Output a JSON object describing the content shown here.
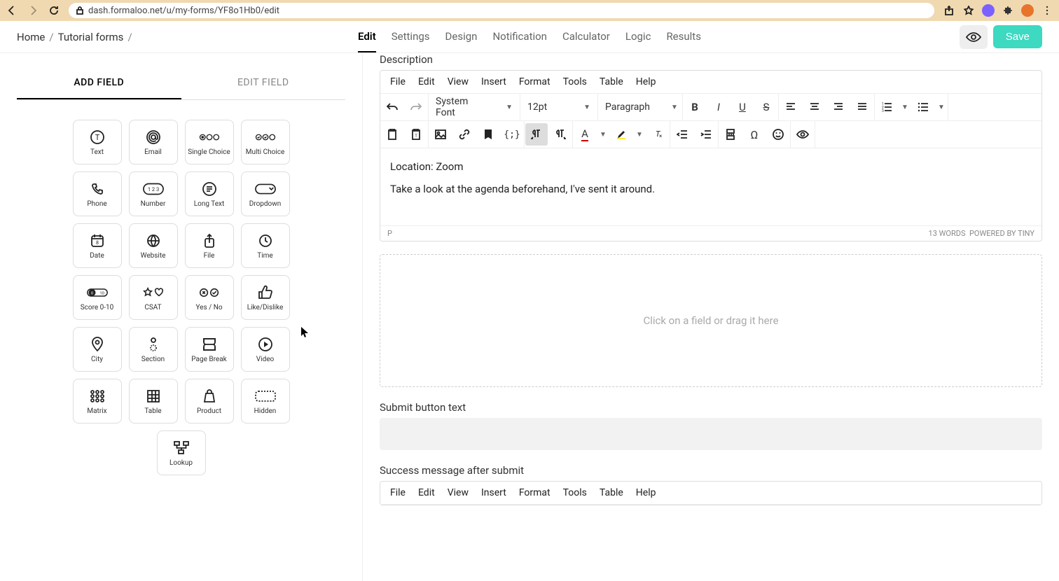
{
  "browser": {
    "url": "dash.formaloo.net/u/my-forms/YF8o1Hb0/edit"
  },
  "breadcrumb": {
    "home": "Home",
    "section": "Tutorial forms"
  },
  "tabs": [
    "Edit",
    "Settings",
    "Design",
    "Notification",
    "Calculator",
    "Logic",
    "Results"
  ],
  "header": {
    "save": "Save"
  },
  "sidebar": {
    "tab_add": "ADD FIELD",
    "tab_edit": "EDIT FIELD",
    "fields": [
      "Text",
      "Email",
      "Single Choice",
      "Multi Choice",
      "Phone",
      "Number",
      "Long Text",
      "Dropdown",
      "Date",
      "Website",
      "File",
      "Time",
      "Score 0-10",
      "CSAT",
      "Yes / No",
      "Like/Dislike",
      "City",
      "Section",
      "Page Break",
      "Video",
      "Matrix",
      "Table",
      "Product",
      "Hidden"
    ],
    "lookup": "Lookup"
  },
  "content": {
    "description_label": "Description",
    "editor_menu": [
      "File",
      "Edit",
      "View",
      "Insert",
      "Format",
      "Tools",
      "Table",
      "Help"
    ],
    "toolbar": {
      "font": "System Font",
      "size": "12pt",
      "paragraph": "Paragraph"
    },
    "body_line1": "Location: Zoom",
    "body_line2": "Take a look at the agenda beforehand, I've sent it around.",
    "status_path": "P",
    "status_words": "13 WORDS",
    "status_powered": "POWERED BY TINY",
    "dropzone": "Click on a field or drag it here",
    "submit_label": "Submit button text",
    "success_label": "Success message after submit"
  }
}
